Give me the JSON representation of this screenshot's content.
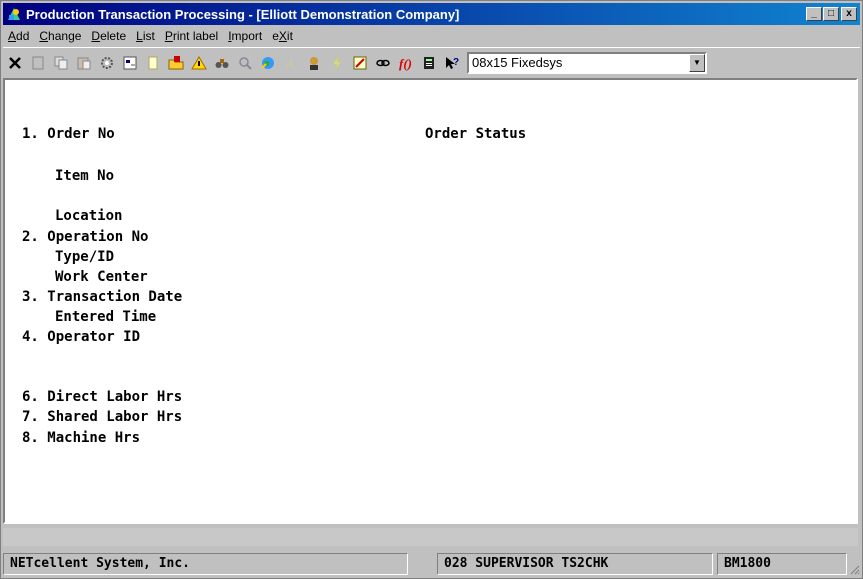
{
  "window": {
    "title": "Production Transaction Processing - [Elliott Demonstration Company]",
    "minimize": "_",
    "maximize": "□",
    "close": "x"
  },
  "menu": [
    {
      "label": "Add",
      "accel": "A"
    },
    {
      "label": "Change",
      "accel": "C"
    },
    {
      "label": "Delete",
      "accel": "D"
    },
    {
      "label": "List",
      "accel": "L"
    },
    {
      "label": "Print label",
      "accel": "P"
    },
    {
      "label": "Import",
      "accel": "I"
    },
    {
      "label": "eXit",
      "accel": "X"
    }
  ],
  "toolbar": {
    "font_select_value": "08x15 Fixedsys",
    "buttons": [
      "close-x",
      "blank",
      "copy",
      "paste",
      "settings",
      "properties",
      "notes",
      "folder-open",
      "warning",
      "binoculars",
      "magnifier",
      "globe",
      "font",
      "user-lookup",
      "lightning",
      "calculator",
      "link",
      "function",
      "calculator-display",
      "help-pointer"
    ]
  },
  "form": {
    "order_no": "1. Order No",
    "order_status": "Order Status",
    "item_no": "Item No",
    "location": "Location",
    "operation_no": "2. Operation No",
    "type_id": "Type/ID",
    "work_center": "Work Center",
    "transaction_date": "3. Transaction Date",
    "entered_time": "Entered Time",
    "operator_id": "4. Operator ID",
    "direct_labor": "6. Direct Labor Hrs",
    "shared_labor": "7. Shared Labor Hrs",
    "machine_hrs": "8. Machine Hrs"
  },
  "status": {
    "company": "NETcellent System, Inc.",
    "user": "028 SUPERVISOR TS2CHK",
    "code": "BM1800"
  }
}
